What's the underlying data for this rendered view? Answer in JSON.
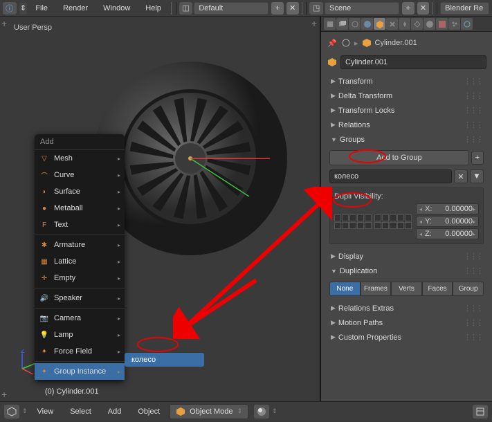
{
  "topbar": {
    "menus": [
      "File",
      "Render",
      "Window",
      "Help"
    ],
    "layout_field": "Default",
    "scene_field": "Scene",
    "engine_field": "Blender Re"
  },
  "viewport": {
    "label": "User Persp",
    "object_name": "(0) Cylinder.001"
  },
  "add_menu": {
    "title": "Add",
    "items_a": [
      "Mesh",
      "Curve",
      "Surface",
      "Metaball",
      "Text"
    ],
    "items_b": [
      "Armature",
      "Lattice",
      "Empty"
    ],
    "items_c": [
      "Speaker"
    ],
    "items_d": [
      "Camera",
      "Lamp",
      "Force Field"
    ],
    "items_e": [
      "Group Instance"
    ],
    "submenu_item": "колесо"
  },
  "props": {
    "breadcrumb": "Cylinder.001",
    "name": "Cylinder.001",
    "panels_closed_a": [
      "Transform",
      "Delta Transform",
      "Transform Locks",
      "Relations"
    ],
    "groups": {
      "title": "Groups",
      "add_btn": "Add to Group",
      "group_name": "колесо",
      "dupli_label": "Dupli Visibility:",
      "coords": [
        {
          "axis": "X:",
          "val": "0.00000"
        },
        {
          "axis": "Y:",
          "val": "0.00000"
        },
        {
          "axis": "Z:",
          "val": "0.00000"
        }
      ]
    },
    "panels_closed_b": [
      "Display"
    ],
    "duplication": {
      "title": "Duplication",
      "tabs": [
        "None",
        "Frames",
        "Verts",
        "Faces",
        "Group"
      ],
      "active": 0
    },
    "panels_closed_c": [
      "Relations Extras",
      "Motion Paths",
      "Custom Properties"
    ]
  },
  "footer": {
    "menus": [
      "View",
      "Select",
      "Add",
      "Object"
    ],
    "mode": "Object Mode"
  },
  "icons": {
    "info": "ⓘ",
    "scene": "◳",
    "cube": "⬢",
    "plus": "+",
    "x": "✕",
    "pin": "📌",
    "link": "🔗",
    "chev_r": "▸",
    "chev_d": "▾",
    "chev_l": "◂",
    "grip": "⋮⋮",
    "dropdown": "⇕",
    "tri_r": "▶",
    "tri_d": "▼"
  }
}
